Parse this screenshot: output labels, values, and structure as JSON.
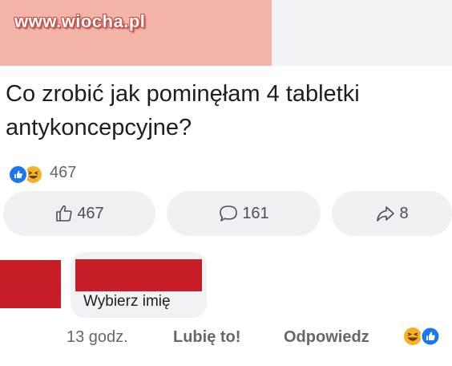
{
  "watermark": {
    "text": "www.wiocha.pl"
  },
  "post": {
    "text": "Co zrobić jak pominęłam 4 tabletki antykoncepcyjne?",
    "reaction_count": "467",
    "reaction_icons": [
      "like-icon",
      "haha-emoji-icon"
    ]
  },
  "actions": {
    "like_count": "467",
    "comment_count": "161",
    "share_count": "8"
  },
  "comment": {
    "text": "Wybierz imię",
    "time": "13 godz.",
    "like_label": "Lubię to!",
    "reply_label": "Odpowiedz",
    "reaction_icons": [
      "haha-emoji-icon",
      "like-icon"
    ]
  },
  "colors": {
    "redaction_red": "#c81e28",
    "redaction_pink": "#f4b5a9",
    "facebook_blue": "#1877f2",
    "haha_yellow": "#f7b125",
    "button_bg": "#eef0f3"
  }
}
